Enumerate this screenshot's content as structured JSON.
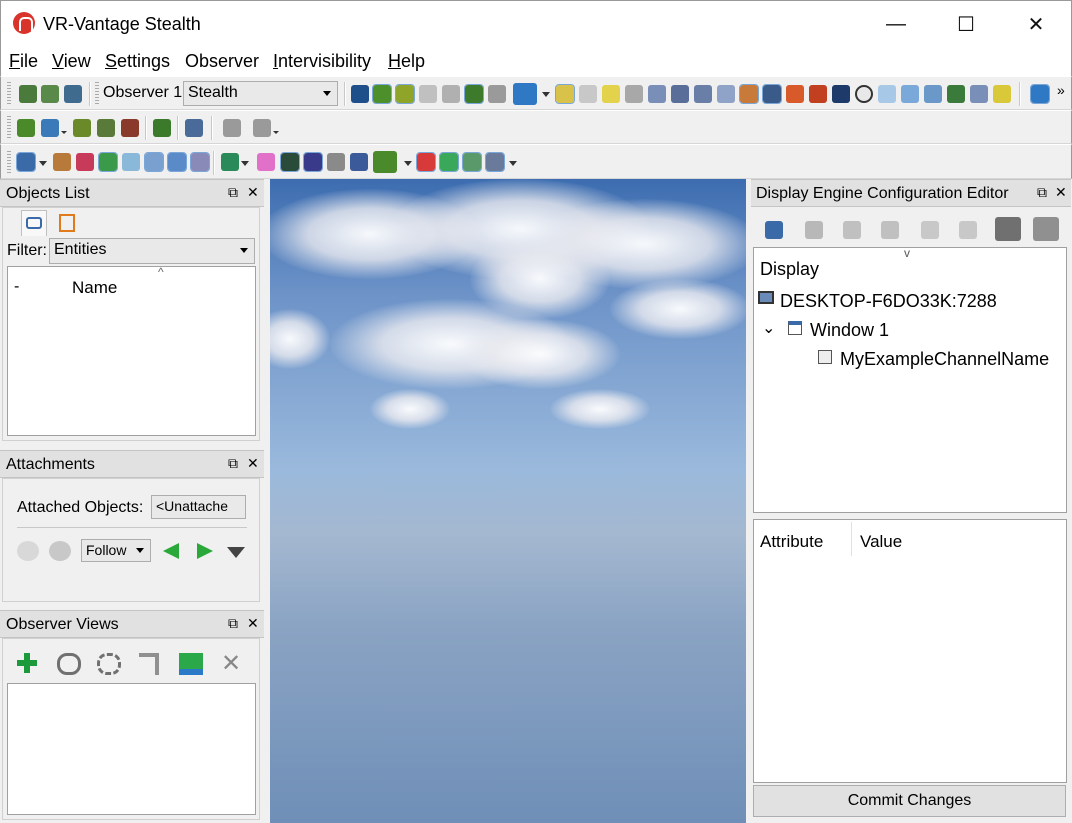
{
  "window": {
    "title": "VR-Vantage Stealth",
    "controls": {
      "minimize": "—",
      "maximize": "☐",
      "close": "✕"
    }
  },
  "menu": [
    {
      "label": "File",
      "mnemonic": "F",
      "rest": "ile"
    },
    {
      "label": "View",
      "mnemonic": "V",
      "rest": "iew"
    },
    {
      "label": "Settings",
      "mnemonic": "S",
      "rest": "ettings"
    },
    {
      "label": "Observer",
      "mnemonic": "",
      "rest": "Observer"
    },
    {
      "label": "Intervisibility",
      "mnemonic": "I",
      "rest": "ntervisibility"
    },
    {
      "label": "Help",
      "mnemonic": "H",
      "rest": "elp"
    }
  ],
  "toolbar1": {
    "observer_label": "Observer 1",
    "observer_mode": "Stealth",
    "overflow": "»"
  },
  "objects_list": {
    "title": "Objects List",
    "filter_label": "Filter:",
    "filter_value": "Entities",
    "columns": [
      "-",
      "Name"
    ]
  },
  "attachments": {
    "title": "Attachments",
    "attached_label": "Attached Objects:",
    "attached_value": "<Unattache",
    "mode_value": "Follow"
  },
  "observer_views": {
    "title": "Observer Views"
  },
  "dece": {
    "title": "Display Engine Configuration Editor",
    "tree_header": "Display",
    "tree": [
      {
        "label": "DESKTOP-F6DO33K:7288",
        "level": 0
      },
      {
        "label": "Window 1",
        "level": 1,
        "expanded": true
      },
      {
        "label": "MyExampleChannelName",
        "level": 2
      }
    ],
    "attr_columns": [
      "Attribute",
      "Value"
    ],
    "commit_label": "Commit Changes"
  },
  "panel_buttons": {
    "float": "⧉",
    "close": "✕"
  },
  "colors": {
    "accent": "#3d6db0",
    "title_icon": "#d9342b"
  }
}
